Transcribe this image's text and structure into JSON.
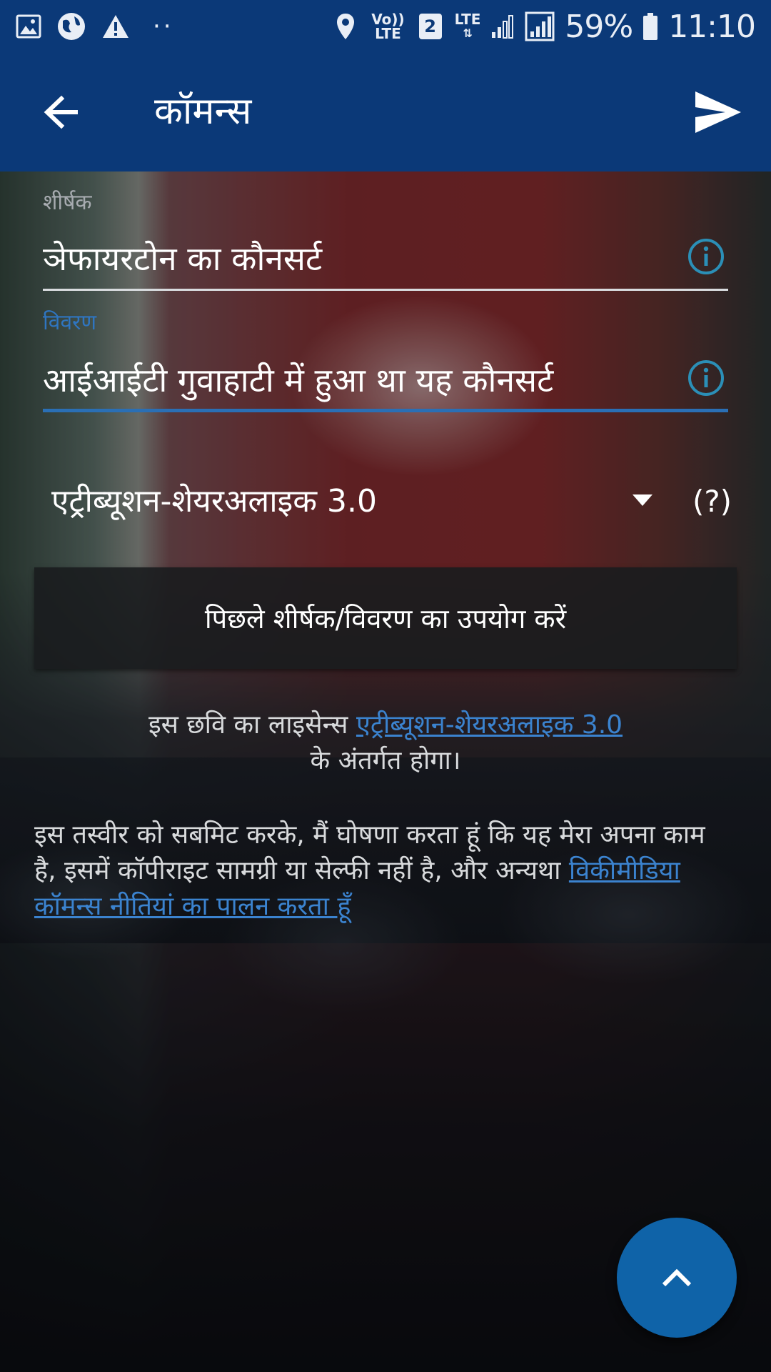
{
  "status_bar": {
    "volte_top": "Vo))",
    "volte_bottom": "LTE",
    "sim_slot": "2",
    "network_type": "LTE",
    "battery_percent": "59%",
    "time": "11:10",
    "icons": [
      "gallery-icon",
      "globe-icon",
      "warning-icon",
      "more-dots-icon",
      "location-icon",
      "volte-icon",
      "sim-icon",
      "data-arrows-icon",
      "signal-icon",
      "signal-icon",
      "battery-icon"
    ]
  },
  "toolbar": {
    "title": "कॉमन्स",
    "back_icon": "arrow-back-icon",
    "send_icon": "send-icon"
  },
  "form": {
    "title_label": "शीर्षक",
    "title_value": "ञेफायरटोन का कौनसर्ट",
    "description_label": "विवरण",
    "description_value": "आईआईटी गुवाहाटी में हुआ था यह कौनसर्ट",
    "license_selected": "एट्रीब्यूशन-शेयरअलाइक 3.0",
    "license_help": "(?)"
  },
  "buttons": {
    "use_previous": "पिछले शीर्षक/विवरण का उपयोग करें"
  },
  "license_note": {
    "prefix": "इस छवि का लाइसेन्स ",
    "link": "एट्रीब्यूशन-शेयरअलाइक 3.0",
    "suffix": "के अंतर्गत होगा।"
  },
  "declaration": {
    "text": "इस तस्वीर को सबमिट करके, मैं घोषणा करता हूं कि यह मेरा अपना काम है, इसमें कॉपीराइट सामग्री या सेल्फी नहीं है, और अन्यथा ",
    "link": "विकीमीडिया कॉमन्स नीतियां का पालन करता हूँ"
  },
  "colors": {
    "app_bar": "#0b3978",
    "accent": "#2a6fb5",
    "link": "#3b83cf",
    "fab": "#0f63a8"
  }
}
